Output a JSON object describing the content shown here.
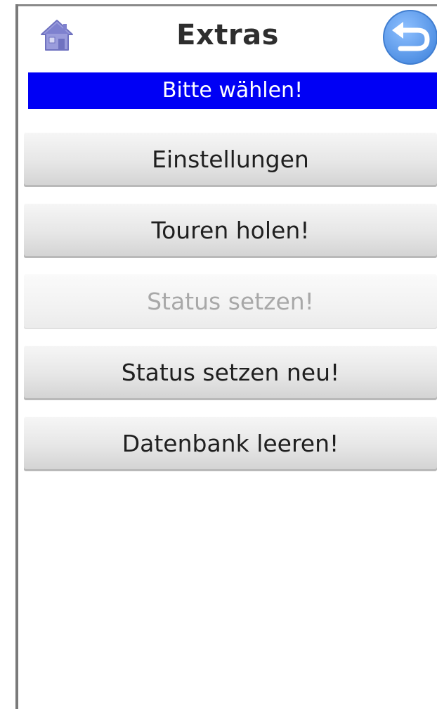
{
  "header": {
    "title": "Extras",
    "home_icon": "home-icon",
    "back_icon": "back-arrow-icon"
  },
  "status": {
    "text": "Bitte wählen!",
    "color": "#0000f5"
  },
  "menu": {
    "items": [
      {
        "label": "Einstellungen",
        "enabled": true
      },
      {
        "label": "Touren holen!",
        "enabled": true
      },
      {
        "label": "Status setzen!",
        "enabled": false
      },
      {
        "label": "Status setzen neu!",
        "enabled": true
      },
      {
        "label": "Datenbank leeren!",
        "enabled": true
      }
    ]
  },
  "colors": {
    "accent_blue": "#5b9ae8",
    "home_icon": "#8c8ed4"
  }
}
